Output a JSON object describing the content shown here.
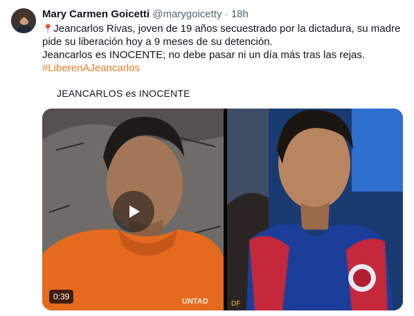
{
  "tweet": {
    "author_name": "Mary Carmen Goicetti",
    "handle": "@marygoicetty",
    "separator": "·",
    "time": "18h",
    "pin_icon": "📍",
    "lines": [
      "Jeancarlos Rivas, joven de 19 años secuestrado por la dictadura, su madre",
      "pide su liberación hoy a 9 meses de su detención.",
      "Jeancarlos es INOCENTE; no debe pasar ni un día más tras las rejas."
    ],
    "hashtag": "#LiberenAJeancarlos"
  },
  "media": {
    "caption": "JEANCARLOS es INOCENTE",
    "video_duration": "0:39",
    "play_icon": "play-icon"
  },
  "colors": {
    "hashtag": "#e67e22",
    "text": "#0f1419",
    "muted": "#536471"
  }
}
